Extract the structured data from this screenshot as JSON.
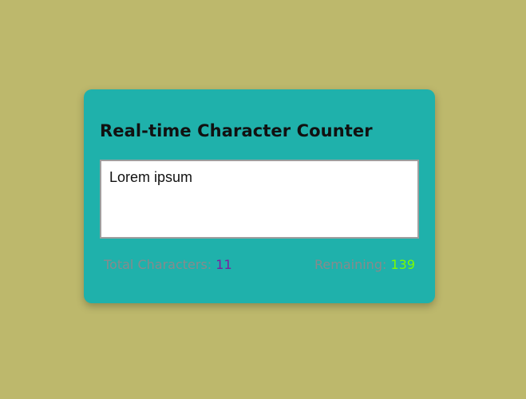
{
  "card": {
    "title": "Real-time Character Counter",
    "textarea_value": "Lorem ipsum"
  },
  "counter": {
    "total_label": "Total Characters:",
    "total_value": "11",
    "remaining_label": "Remaining:",
    "remaining_value": "139"
  },
  "colors": {
    "page_background": "#bdb86c",
    "card_background": "#1fb1ab",
    "total_value_color": "#7a1fa0",
    "remaining_value_color": "#7cfc00"
  }
}
